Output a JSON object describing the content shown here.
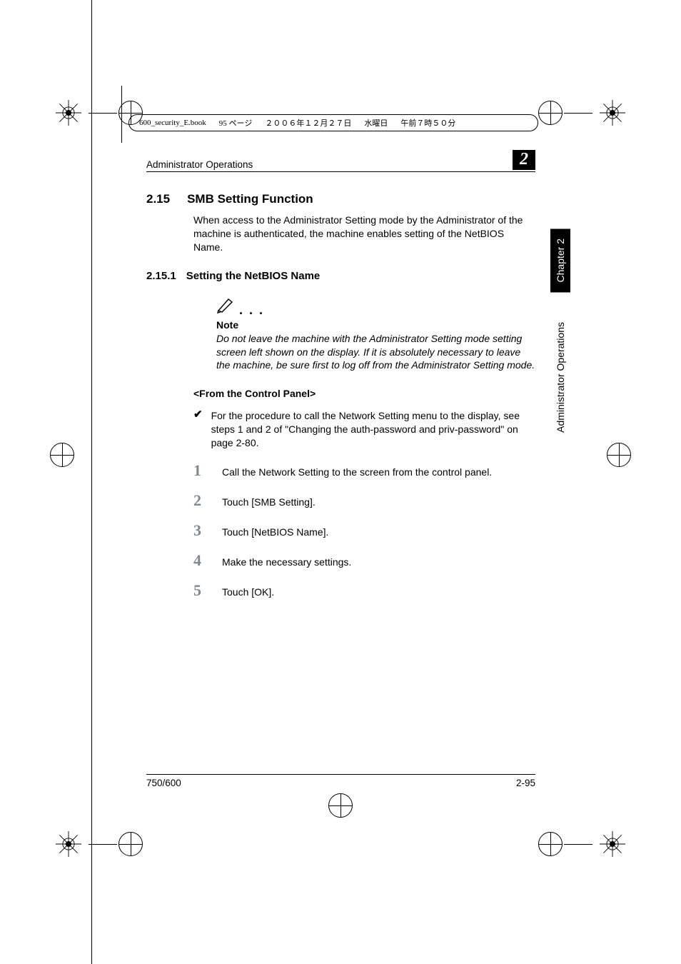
{
  "meta": {
    "file": "600_security_E.book",
    "page_fragment": "95 ページ",
    "date": "２００６年１２月２７日",
    "day": "水曜日",
    "time": "午前７時５０分"
  },
  "header": {
    "title": "Administrator Operations",
    "chapter_badge": "2"
  },
  "section": {
    "num": "2.15",
    "title": "SMB Setting Function",
    "intro": "When access to the Administrator Setting mode by the Administrator of the machine is authenticated, the machine enables setting of the NetBIOS Name."
  },
  "subsection": {
    "num": "2.15.1",
    "title": "Setting the NetBIOS Name"
  },
  "note": {
    "label": "Note",
    "body": "Do not leave the machine with the Administrator Setting mode setting screen left shown on the display. If it is absolutely necessary to leave the machine, be sure first to log off from the Administrator Setting mode."
  },
  "panel_heading": "<From the Control Panel>",
  "check_text": "For the procedure to call the Network Setting menu to the display, see steps 1 and 2 of \"Changing the auth-password and priv-password\" on page 2-80.",
  "steps": [
    {
      "n": "1",
      "t": "Call the Network Setting to the screen from the control panel."
    },
    {
      "n": "2",
      "t": "Touch [SMB Setting]."
    },
    {
      "n": "3",
      "t": "Touch [NetBIOS Name]."
    },
    {
      "n": "4",
      "t": "Make the necessary settings."
    },
    {
      "n": "5",
      "t": "Touch [OK]."
    }
  ],
  "side": {
    "chapter": "Chapter 2",
    "section": "Administrator Operations"
  },
  "footer": {
    "left": "750/600",
    "right": "2-95"
  }
}
